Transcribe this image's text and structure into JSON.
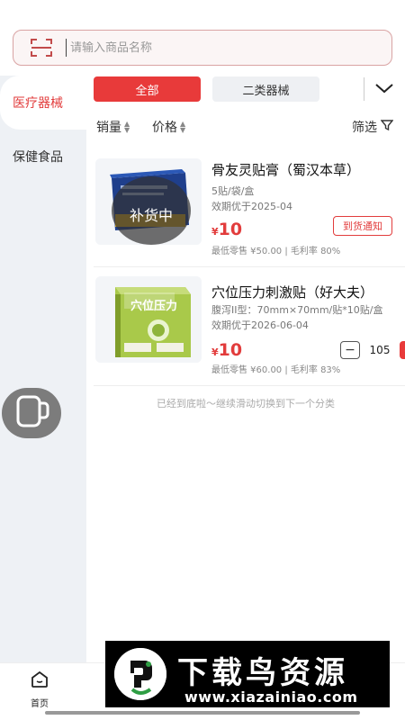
{
  "search": {
    "placeholder": "请输入商品名称",
    "scan_icon": "scan-icon"
  },
  "sidebar": {
    "items": [
      {
        "label": "医疗器械",
        "active": true
      },
      {
        "label": "保健食品",
        "active": false
      }
    ]
  },
  "tabs": {
    "items": [
      {
        "label": "全部",
        "active": true
      },
      {
        "label": "二类器械",
        "active": false
      }
    ],
    "more_icon": "chevron-down-icon"
  },
  "sort": {
    "sales_label": "销量",
    "price_label": "价格",
    "filter_label": "筛选",
    "filter_icon": "filter-icon"
  },
  "products": [
    {
      "title": "骨友灵贴膏（蜀汉本草）",
      "spec": "5贴/袋/盒",
      "expiry": "效期优于2025-04",
      "currency": "¥",
      "price": "10",
      "meta": "最低零售 ¥50.00 | 毛利率 80%",
      "overlay": "补货中",
      "action_label": "到货通知",
      "box_text": "骨友灵贴膏"
    },
    {
      "title": "穴位压力刺激贴（好大夫）",
      "spec": "腹泻II型：70mm×70mm/贴*10贴/盒",
      "expiry": "效期优于2026-06-04",
      "currency": "¥",
      "price": "10",
      "meta": "最低零售 ¥60.00 | 毛利率 83%",
      "quantity": "105",
      "box_text": "穴位压力"
    }
  ],
  "list_end_text": "已经到底啦～继续滑动切换到下一个分类",
  "bottom_nav": {
    "home_label": "首页",
    "home_icon": "home-icon"
  },
  "watermark": {
    "title": "下载鸟资源",
    "url": "www.xiazainiao.com"
  },
  "colors": {
    "accent": "#e83a3a",
    "sidebar_bg": "#eef1f5",
    "search_border": "#d9a3a3"
  }
}
